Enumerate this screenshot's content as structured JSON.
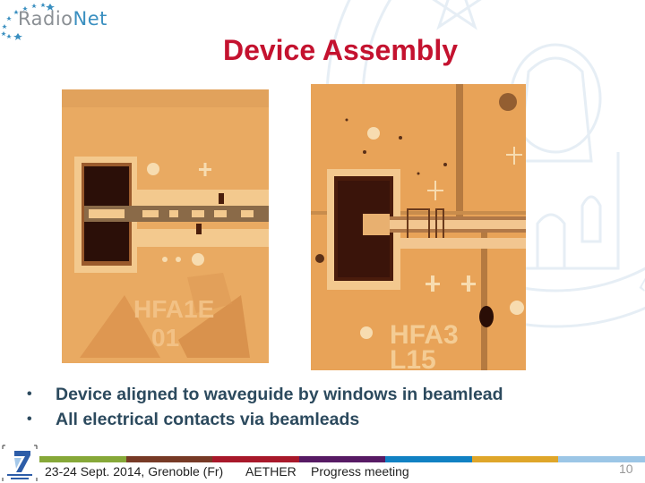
{
  "header": {
    "logo": {
      "part1": "Radio",
      "part2": "Net",
      "icon": "stars-arc-icon"
    },
    "watermark": "university-seal-icon"
  },
  "slide": {
    "title": "Device Assembly",
    "images": [
      {
        "name": "micrograph-device-left",
        "label_text": "HFA1E 01"
      },
      {
        "name": "micrograph-device-right",
        "label_text": "HFA3 L15"
      }
    ],
    "bullets": [
      "Device aligned to waveguide by windows in beamlead",
      "All electrical contacts via beamleads"
    ],
    "bullet_glyph": "•"
  },
  "footer": {
    "logo": "fp7-logo-icon",
    "date_location": "23-24  Sept. 2014, Grenoble (Fr)",
    "project": "AETHER",
    "meeting": "Progress meeting",
    "page_number": "10",
    "colorbar": [
      "#86a838",
      "#773a26",
      "#a8182a",
      "#571a64",
      "#1181c3",
      "#dfa62a",
      "#9cc6e6"
    ]
  },
  "colors": {
    "title": "#c4122f",
    "bullet_text": "#2c4a5e",
    "logo_grey": "#8a8f94",
    "logo_blue": "#3a8fc0"
  }
}
